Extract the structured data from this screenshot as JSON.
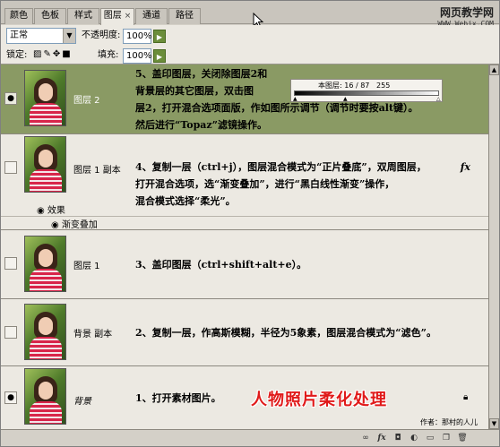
{
  "tabs": [
    "颜色",
    "色板",
    "样式",
    "图层",
    "通道",
    "路径"
  ],
  "active_tab": "图层",
  "tab_close": "×",
  "watermark": {
    "line1": "网页教学网",
    "line2": "WWW.Webjx.COM"
  },
  "blend_mode": "正常",
  "opacity": {
    "label": "不透明度:",
    "value": "100%"
  },
  "lock": {
    "label": "锁定:"
  },
  "fill": {
    "label": "填充:",
    "value": "100%"
  },
  "layers": [
    {
      "name": "图层 2",
      "selected": true,
      "visible": true,
      "desc": "5、盖印图层，关闭除图层2和\n背景层的其它图层，双击图\n层2，打开混合选项面版，作如图所示调节（调节时要按alt键）。\n然后进行“Topaz”滤镜操作。",
      "gradient_info": {
        "label": "本图层:",
        "v1": "16",
        "v2": "87",
        "v3": "255"
      }
    },
    {
      "name": "图层 1 副本",
      "selected": false,
      "visible": false,
      "desc": "4、复制一层（ctrl+j），图层混合模式为“正片叠底”，双周图层，\n打开混合选项，选“渐变叠加”，进行“黑白线性渐变”操作，\n混合模式选择“柔光”。",
      "fx": "fx",
      "effects_label": "效果",
      "effect_item": "渐变叠加"
    },
    {
      "name": "图层 1",
      "selected": false,
      "visible": false,
      "desc": "3、盖印图层（ctrl+shift+alt+e）。"
    },
    {
      "name": "背景 副本",
      "selected": false,
      "visible": false,
      "desc": "2、复制一层，作高斯模糊，半径为5象素，图层混合模式为“滤色”。"
    },
    {
      "name": "背景",
      "selected": false,
      "visible": true,
      "desc": "1、打开素材图片。"
    }
  ],
  "overlay_title": "人物照片柔化处理",
  "author": "作者：那村的人儿",
  "colors": {
    "selected_row": "#8a9a64",
    "title_red": "#e01a1a",
    "panel_bg": "#ece9e2"
  },
  "icons": [
    "link-icon",
    "fx-icon",
    "mask-icon",
    "adjustment-icon",
    "folder-icon",
    "new-layer-icon",
    "trash-icon"
  ]
}
